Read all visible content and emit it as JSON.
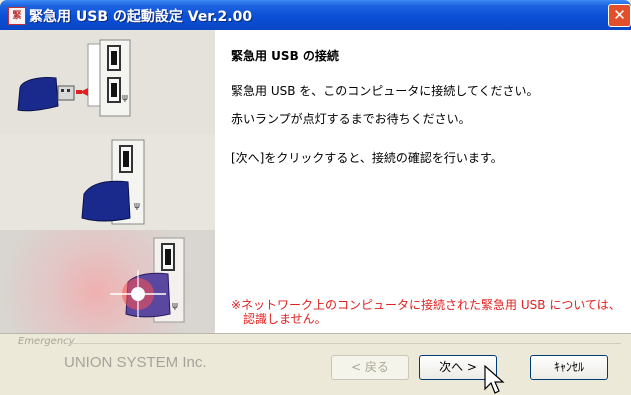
{
  "window": {
    "title": "緊急用 USB の起動設定 Ver.2.00",
    "icon_label": "緊",
    "close_glyph": "✕"
  },
  "content": {
    "heading": "緊急用 USB の接続",
    "line1": "緊急用 USB を、このコンピュータに接続してください。",
    "line2": "赤いランプが点灯するまでお待ちください。",
    "line3": "[次へ]をクリックすると、接続の確認を行います。",
    "warning": "※ネットワーク上のコンピュータに接続された緊急用 USB については、\n　認識しません。"
  },
  "footer": {
    "emergency_label": "Emergency",
    "company": "UNION SYSTEM Inc.",
    "back_label": "< 戻る",
    "next_label": "次へ >",
    "cancel_label": "ｷｬﾝｾﾙ"
  },
  "colors": {
    "titlebar": "#0b4fd8",
    "warning_text": "#e02020",
    "usb_body": "#1a2a8c"
  }
}
